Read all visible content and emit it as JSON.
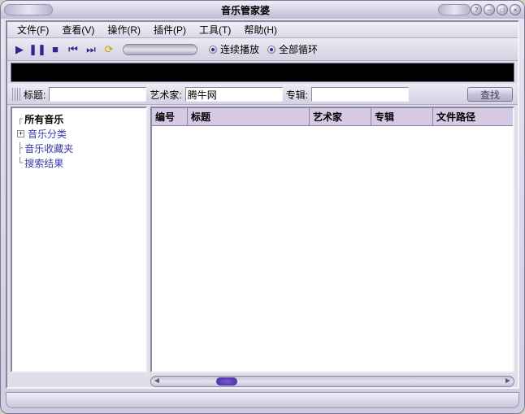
{
  "window": {
    "title": "音乐管家婆"
  },
  "menu": {
    "file": "文件(F)",
    "view": "查看(V)",
    "operate": "操作(R)",
    "plugins": "插件(P)",
    "tools": "工具(T)",
    "help": "帮助(H)"
  },
  "playback": {
    "repeat_label": "连续播放",
    "loop_all_label": "全部循环",
    "repeat_selected": true,
    "loop_all_selected": true
  },
  "search": {
    "title_label": "标题:",
    "artist_label": "艺术家:",
    "album_label": "专辑:",
    "title_value": "",
    "artist_value": "腾牛网",
    "album_value": "",
    "find_label": "查找"
  },
  "tree": {
    "items": [
      {
        "label": "所有音乐",
        "selected": true,
        "expandable": false
      },
      {
        "label": "音乐分类",
        "selected": false,
        "expandable": true
      },
      {
        "label": "音乐收藏夹",
        "selected": false,
        "expandable": false
      },
      {
        "label": "搜索结果",
        "selected": false,
        "expandable": false
      }
    ]
  },
  "columns": {
    "number": "编号",
    "title": "标题",
    "artist": "艺术家",
    "album": "专辑",
    "path": "文件路径"
  },
  "rows": []
}
